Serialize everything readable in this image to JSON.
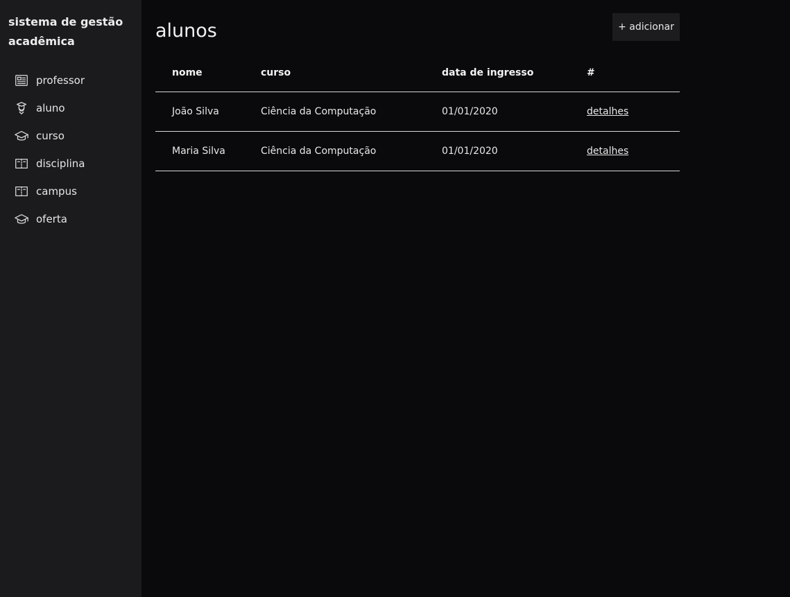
{
  "sidebar": {
    "title": "sistema de gestão acadêmica",
    "items": [
      {
        "label": "professor",
        "icon": "id-card-icon"
      },
      {
        "label": "aluno",
        "icon": "student-icon"
      },
      {
        "label": "curso",
        "icon": "graduation-cap-icon"
      },
      {
        "label": "disciplina",
        "icon": "book-icon"
      },
      {
        "label": "campus",
        "icon": "book-icon"
      },
      {
        "label": "oferta",
        "icon": "graduation-cap-icon"
      }
    ]
  },
  "main": {
    "title": "alunos",
    "add_label": "+ adicionar",
    "table": {
      "headers": [
        "nome",
        "curso",
        "data de ingresso",
        "#"
      ],
      "rows": [
        {
          "nome": "João Silva",
          "curso": "Ciência da Computação",
          "data": "01/01/2020",
          "link": "detalhes"
        },
        {
          "nome": "Maria Silva",
          "curso": "Ciência da Computação",
          "data": "01/01/2020",
          "link": "detalhes"
        }
      ]
    }
  }
}
